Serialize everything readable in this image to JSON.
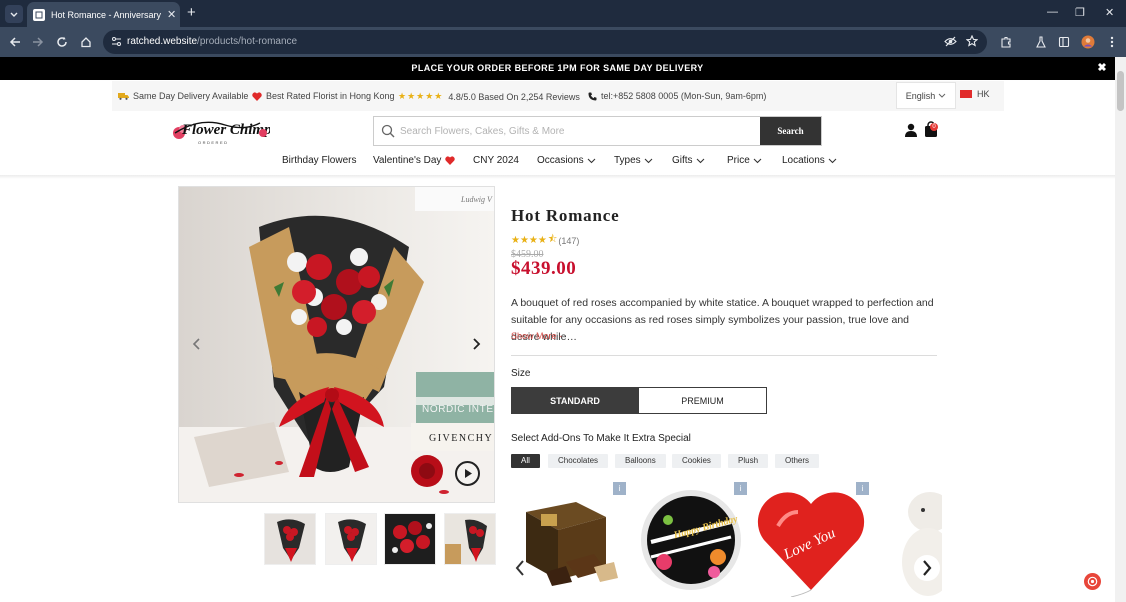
{
  "browser": {
    "tab_title": "Hot Romance - Anniversary Flo",
    "url_host": "ratched.website",
    "url_path": "/products/hot-romance",
    "new_tab_symbol": "+",
    "close_symbol": "✕"
  },
  "promo": {
    "text": "PLACE YOUR ORDER BEFORE 1PM FOR SAME DAY DELIVERY"
  },
  "infobar": {
    "same_day": "Same Day Delivery Available",
    "best_rated": "Best Rated Florist in Hong Kong",
    "rating_stars": "★★★★★",
    "rating_text": "4.8/5.0 Based On 2,254 Reviews",
    "phone": "tel:+852 5808 0005 (Mon-Sun, 9am-6pm)",
    "language": "English",
    "region": "HK"
  },
  "search": {
    "placeholder": "Search Flowers, Cakes, Gifts & More",
    "value": "",
    "button": "Search"
  },
  "cart": {
    "count": "0"
  },
  "menu": [
    {
      "label": "Birthday Flowers"
    },
    {
      "label": "Valentine's Day"
    },
    {
      "label": "CNY 2024"
    },
    {
      "label": "Occasions"
    },
    {
      "label": "Types"
    },
    {
      "label": "Gifts"
    },
    {
      "label": "Price"
    },
    {
      "label": "Locations"
    }
  ],
  "product": {
    "title": "Hot Romance",
    "stars": "★★★★",
    "half_star": "⯪",
    "review_count": "(147)",
    "old_price": "$459.00",
    "price": "$439.00",
    "description": "A bouquet of red roses accompanied by white statice. A bouquet wrapped to perfection and suitable for any occasions as red roses simply symbolizes your passion, true love and desire while…",
    "show_more": "Show More -",
    "size_label": "Size",
    "sizes": [
      "STANDARD",
      "PREMIUM"
    ],
    "addons_label": "Select Add-Ons To Make It Extra Special",
    "addon_filters": [
      "All",
      "Chocolates",
      "Balloons",
      "Cookies",
      "Plush",
      "Others"
    ],
    "image_text_book": "NORDIC INTER",
    "image_text_box": "GIVENCHY",
    "image_text_sign": "Ludwig V",
    "balloon_text": "Happy Birthday",
    "heart_text": "Love You",
    "info_badge": "i"
  },
  "colors": {
    "accent_red": "#c8102e",
    "dark_button": "#333333",
    "star_gold": "#e9b116",
    "browser_frame": "#1f2b3e"
  }
}
